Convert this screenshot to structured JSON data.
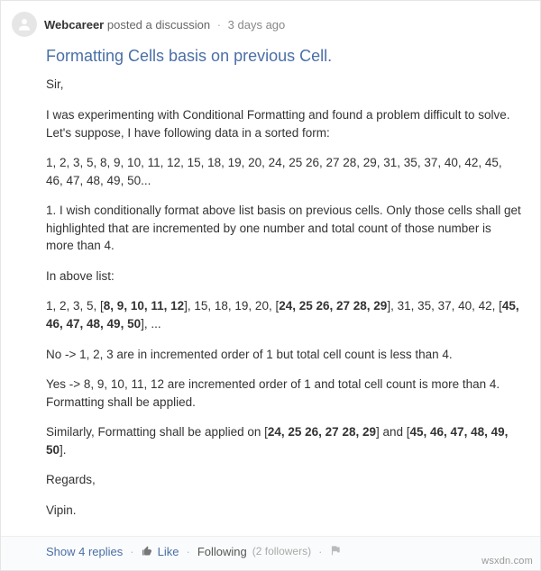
{
  "header": {
    "author": "Webcareer",
    "action": "posted a discussion",
    "time": "3 days ago"
  },
  "title": "Formatting Cells basis on previous Cell.",
  "paragraphs": {
    "p1": "Sir,",
    "p2": "I was experimenting with Conditional Formatting and found a problem difficult to solve. Let's suppose, I have following data in a sorted form:",
    "p3": "1, 2, 3, 5, 8, 9, 10, 11, 12, 15, 18, 19, 20, 24, 25 26, 27 28, 29, 31, 35, 37, 40, 42, 45, 46, 47, 48, 49, 50...",
    "p4": "1. I wish conditionally format above list basis on previous cells. Only those cells shall get highlighted that are incremented by one number and total count of those number is more than 4.",
    "p5": "In above list:",
    "p6_pre": "1, 2, 3, 5, [",
    "p6_b1": "8, 9, 10, 11, 12",
    "p6_mid1": "], 15, 18, 19, 20, [",
    "p6_b2": "24, 25 26, 27 28, 29",
    "p6_mid2": "], 31, 35, 37, 40, 42, [",
    "p6_b3": "45, 46, 47, 48, 49, 50",
    "p6_post": "], ...",
    "p7": "No -> 1, 2, 3 are in incremented order of 1 but total cell count is less than 4.",
    "p8": "Yes -> 8, 9, 10, 11, 12 are incremented order of 1 and total cell count is more than 4. Formatting shall be applied.",
    "p9_pre": "Similarly, Formatting shall be applied on [",
    "p9_b1": "24, 25 26, 27 28, 29",
    "p9_mid": "] and [",
    "p9_b2": "45, 46, 47, 48, 49, 50",
    "p9_post": "].",
    "p10": "Regards,",
    "p11": "Vipin."
  },
  "actions": {
    "show_replies": "Show 4 replies",
    "like": "Like",
    "following": "Following",
    "followers": "(2 followers)"
  },
  "watermark": "wsxdn.com"
}
